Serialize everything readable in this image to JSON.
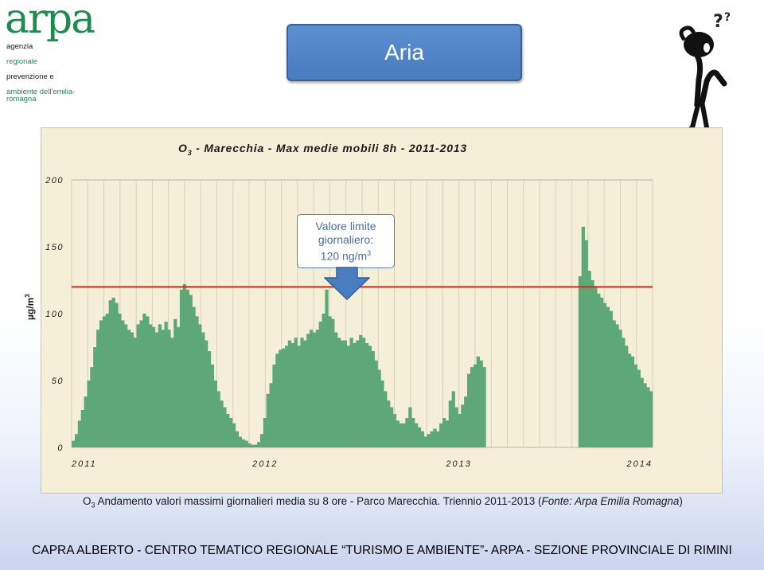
{
  "logo": {
    "word": "arpa",
    "lines": [
      "agenzia",
      "regionale",
      "prevenzione e",
      "ambiente dell'emilia-romagna"
    ]
  },
  "header": {
    "title": "Aria"
  },
  "colors": {
    "bar": "#5ea777",
    "limit_line": "#e2231a",
    "title_box": "#4a7cc0"
  },
  "chart_data": {
    "type": "bar",
    "title_prefix": "O",
    "title_sub": "3",
    "title_rest": " - Marecchia - Max medie mobili 8h - 2011-2013",
    "ylabel": "µg/m",
    "ylabel_sup": "3",
    "ylim": [
      0,
      200
    ],
    "yticks": [
      "0",
      "50",
      "100",
      "150",
      "200"
    ],
    "xticks": [
      "2011",
      "2012",
      "2013",
      "2014"
    ],
    "grid": true,
    "limit_value": 120,
    "series": [
      {
        "bins": [
          5,
          10,
          20,
          28,
          38,
          50,
          60,
          75,
          88,
          95,
          98,
          100,
          110,
          112,
          108,
          100,
          95,
          92,
          88,
          86,
          82,
          92,
          95,
          100,
          98,
          92,
          90,
          86,
          92,
          88,
          94,
          88,
          82,
          96,
          90,
          118,
          122,
          118,
          114,
          105,
          98,
          92,
          86,
          80,
          72,
          62,
          50,
          42,
          35,
          30,
          25,
          22,
          18,
          12,
          8,
          6,
          5,
          3,
          2,
          2,
          4,
          10,
          22,
          40,
          48,
          62,
          70,
          73,
          74,
          76,
          80,
          78,
          82,
          76,
          82,
          80,
          85,
          88,
          86,
          88,
          94,
          100,
          118,
          98,
          96,
          86,
          82,
          80,
          80,
          76,
          82,
          78,
          80,
          84,
          82,
          78,
          76,
          72,
          65,
          58,
          50,
          42,
          35,
          30,
          25,
          20,
          18,
          18,
          22,
          30,
          22,
          18,
          15,
          12,
          8,
          10,
          12,
          14,
          12,
          18,
          22,
          20,
          35,
          42,
          30,
          25,
          32,
          38,
          55,
          60,
          62,
          68,
          65,
          60,
          0,
          0,
          0,
          0,
          0,
          0,
          0,
          0,
          0,
          0,
          0,
          0,
          0,
          0,
          0,
          0,
          0,
          0,
          0,
          0,
          0,
          0,
          0,
          0,
          0,
          0,
          0,
          0,
          0,
          0,
          128,
          165,
          155,
          132,
          125,
          120,
          115,
          112,
          108,
          105,
          102,
          95,
          92,
          88,
          82,
          76,
          70,
          68,
          62,
          58,
          52,
          48,
          45,
          42
        ]
      }
    ]
  },
  "callout": {
    "line1": "Valore limite",
    "line2": "giornaliero:",
    "line3": "120 ng/m",
    "line3_sup": "3"
  },
  "caption": {
    "prefix": "O",
    "sub": "3",
    "main": " Andamento valori massimi giornalieri media su 8 ore - Parco Marecchia. Triennio 2011-2013 (",
    "source": "Fonte: Arpa Emilia Romagna",
    "suffix": ")"
  },
  "footer": {
    "text": "CAPRA ALBERTO - CENTRO TEMATICO REGIONALE “TURISMO E AMBIENTE”- ARPA - SEZIONE PROVINCIALE DI RIMINI"
  }
}
